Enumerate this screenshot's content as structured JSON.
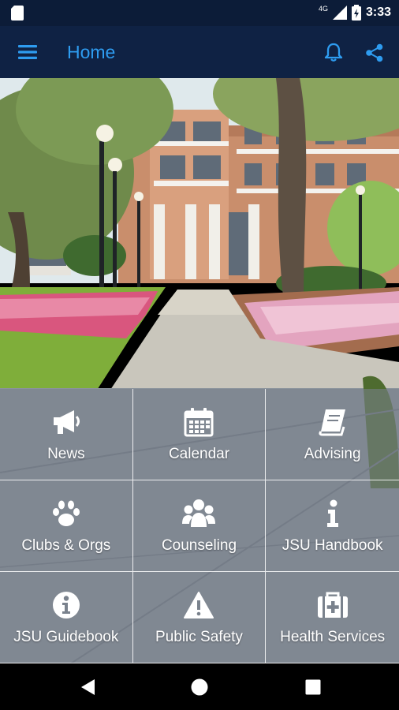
{
  "status_bar": {
    "network": "4G",
    "time": "3:33"
  },
  "app_bar": {
    "title": "Home",
    "menu_icon": "hamburger-menu-icon",
    "notification_icon": "bell-icon",
    "share_icon": "share-icon"
  },
  "colors": {
    "status_bar_bg": "#0c1c38",
    "app_bar_bg": "#0f2244",
    "title_color": "#2e9cf0",
    "tile_overlay": "rgba(120,128,140,0.58)"
  },
  "tiles": [
    {
      "label": "News",
      "icon": "megaphone-icon"
    },
    {
      "label": "Calendar",
      "icon": "calendar-icon"
    },
    {
      "label": "Advising",
      "icon": "book-icon"
    },
    {
      "label": "Clubs & Orgs",
      "icon": "paw-icon"
    },
    {
      "label": "Counseling",
      "icon": "users-group-icon"
    },
    {
      "label": "JSU Handbook",
      "icon": "info-icon"
    },
    {
      "label": "JSU Guidebook",
      "icon": "info-circle-icon"
    },
    {
      "label": "Public Safety",
      "icon": "warning-icon"
    },
    {
      "label": "Health Services",
      "icon": "medical-kit-icon"
    }
  ],
  "nav_bar": {
    "back_icon": "back-triangle-icon",
    "home_icon": "home-circle-icon",
    "recents_icon": "recents-square-icon"
  }
}
